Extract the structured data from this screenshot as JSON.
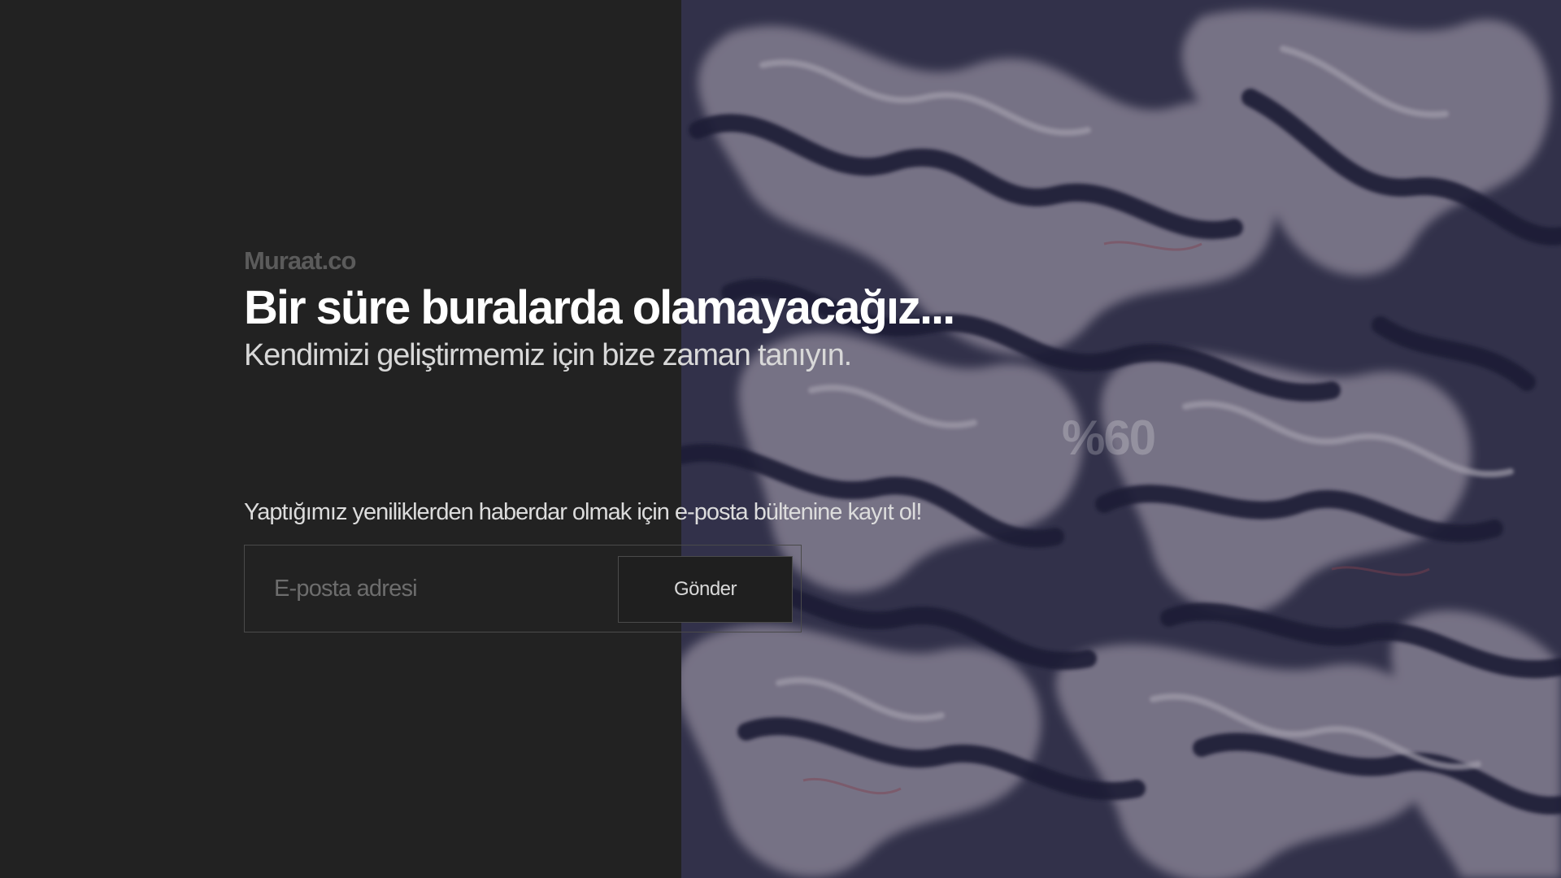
{
  "brand": {
    "name": "Muraat.co"
  },
  "hero": {
    "headline": "Bir süre buralarda olamayacağız...",
    "subheadline": "Kendimizi geliştirmemiz için bize zaman tanıyın."
  },
  "progress": {
    "label": "%60",
    "value_percent": 60
  },
  "newsletter": {
    "prompt": "Yaptığımız yeniliklerden haberdar olmak için e-posta bültenine kayıt ol!",
    "email_placeholder": "E-posta adresi",
    "email_value": "",
    "submit_label": "Gönder"
  },
  "colors": {
    "background": "#222222",
    "art_base": "#3e3d5a",
    "art_light": "#b9b3c6",
    "art_dark": "#1f1e3c",
    "text_primary": "#ffffff",
    "text_muted": "#5b5b5b"
  }
}
